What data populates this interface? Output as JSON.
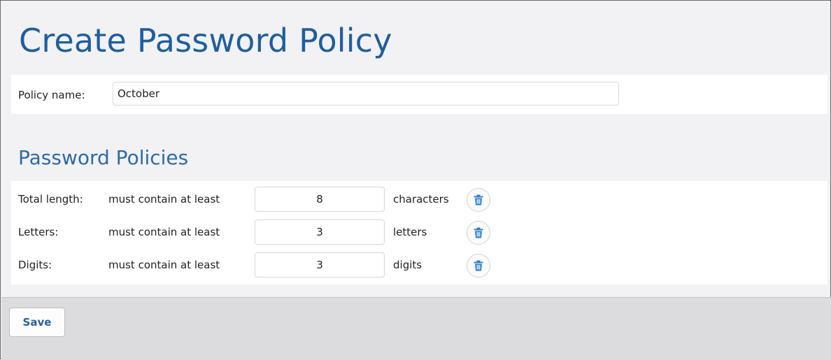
{
  "page": {
    "title": "Create Password Policy"
  },
  "policy_name": {
    "label": "Policy name:",
    "value": "October"
  },
  "section": {
    "title": "Password Policies"
  },
  "rules": [
    {
      "label": "Total length:",
      "requirement": "must contain at least",
      "value": "8",
      "unit": "characters",
      "delete_icon": "trash-icon"
    },
    {
      "label": "Letters:",
      "requirement": "must contain at least",
      "value": "3",
      "unit": "letters",
      "delete_icon": "trash-icon"
    },
    {
      "label": "Digits:",
      "requirement": "must contain at least",
      "value": "3",
      "unit": "digits",
      "delete_icon": "trash-icon"
    }
  ],
  "footer": {
    "save_label": "Save"
  },
  "colors": {
    "title": "#1f5e9e",
    "accent": "#2a5f99",
    "icon": "#2b7fd0",
    "page_bg": "#f2f2f4",
    "footer_bg": "#dcdcde"
  }
}
